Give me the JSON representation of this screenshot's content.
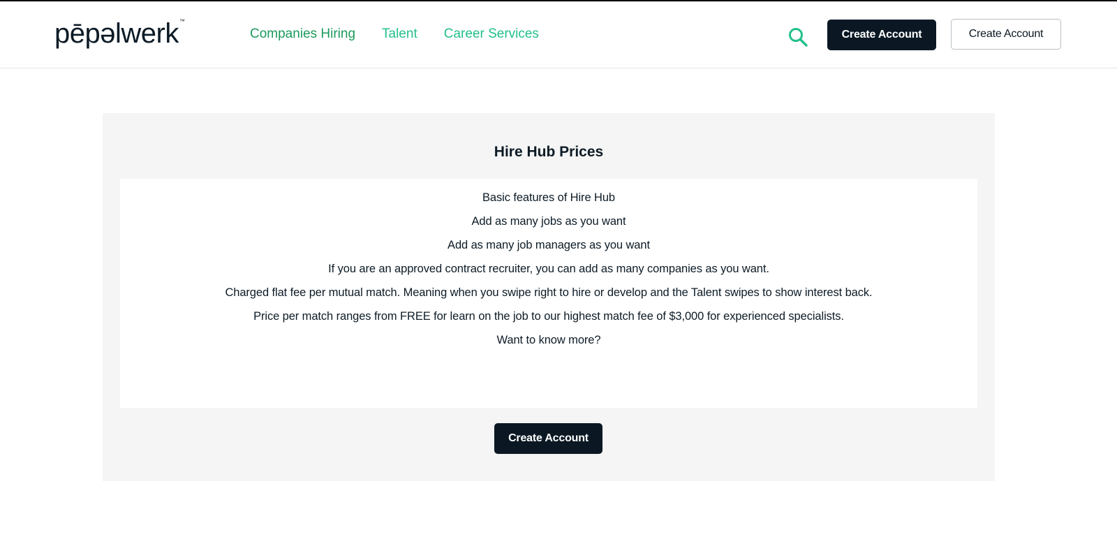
{
  "header": {
    "logo_text": "pēpəlwerk",
    "logo_tm": "™",
    "nav": [
      {
        "label": "Companies Hiring"
      },
      {
        "label": "Talent"
      },
      {
        "label": "Career Services"
      }
    ],
    "primary_button_label": "Create Account",
    "secondary_button_label": "Create Account"
  },
  "pricing": {
    "title": "Hire Hub Prices",
    "features": [
      "Basic features of Hire Hub",
      "Add as many jobs as you want",
      "Add as many job managers as you want",
      "If you are an approved contract recruiter, you can add as many companies as you want.",
      "Charged flat fee per mutual match. Meaning when you swipe right to hire or develop and the Talent swipes to show interest back.",
      "Price per match ranges from FREE for learn on the job to our highest match fee of $3,000 for experienced specialists.",
      "Want to know more?"
    ],
    "cta_label": "Create Account"
  },
  "colors": {
    "brand_dark": "#0b1824",
    "nav_green_dark": "#1a9a5c",
    "nav_green": "#22c08a",
    "card_bg": "#f4f5f4"
  },
  "icons": {
    "search": "search-icon"
  }
}
